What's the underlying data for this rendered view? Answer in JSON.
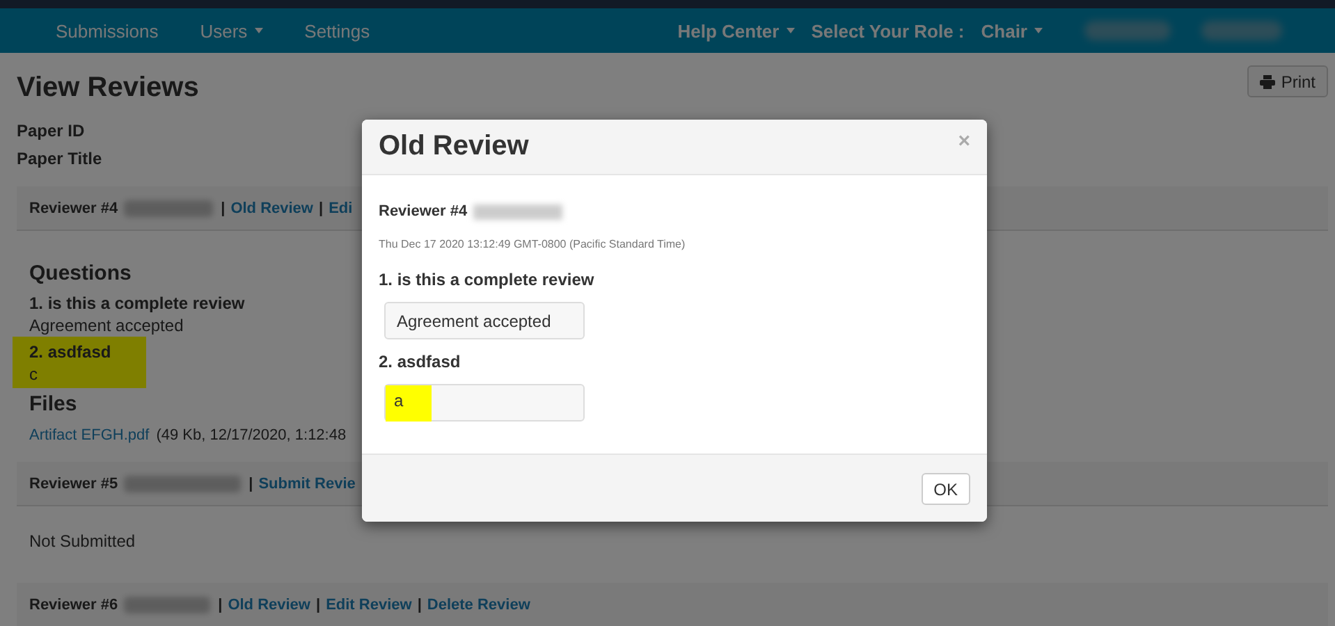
{
  "navbar": {
    "left_items": [
      {
        "label": "Submissions",
        "dropdown": false
      },
      {
        "label": "Users",
        "dropdown": true
      },
      {
        "label": "Settings",
        "dropdown": false
      }
    ],
    "right_items": [
      {
        "label": "Help Center",
        "dropdown": true
      },
      {
        "label": "Select Your Role :",
        "dropdown": false
      },
      {
        "label": "Chair",
        "dropdown": true
      }
    ]
  },
  "page": {
    "title": "View Reviews",
    "print_button": "Print",
    "fields": [
      "Paper ID",
      "Paper Title"
    ]
  },
  "reviewers": [
    {
      "label": "Reviewer #4",
      "actions": [
        {
          "kind": "sep",
          "text": "|"
        },
        {
          "kind": "link",
          "text": "Old Review"
        },
        {
          "kind": "sep",
          "text": "|"
        },
        {
          "kind": "link",
          "text": "Edi"
        }
      ],
      "questions_heading": "Questions",
      "questions": [
        {
          "question": "1. is this a complete review",
          "answer": "Agreement accepted",
          "highlighted": false
        },
        {
          "question": "2. asdfasd",
          "answer": "c",
          "highlighted": true
        }
      ],
      "files_heading": "Files",
      "files": [
        {
          "name": "Artifact EFGH.pdf",
          "meta": "(49 Kb, 12/17/2020, 1:12:48"
        }
      ]
    },
    {
      "label": "Reviewer #5",
      "actions": [
        {
          "kind": "sep",
          "text": "|"
        },
        {
          "kind": "link",
          "text": "Submit Revie"
        }
      ],
      "status": "Not Submitted"
    },
    {
      "label": "Reviewer #6",
      "actions": [
        {
          "kind": "sep",
          "text": "|"
        },
        {
          "kind": "link",
          "text": "Old Review"
        },
        {
          "kind": "sep",
          "text": "|"
        },
        {
          "kind": "link",
          "text": "Edit Review"
        },
        {
          "kind": "sep",
          "text": "|"
        },
        {
          "kind": "link",
          "text": "Delete Review"
        }
      ]
    }
  ],
  "modal": {
    "title": "Old Review",
    "close": "×",
    "reviewer": "Reviewer #4",
    "timestamp": "Thu Dec 17 2020 13:12:49 GMT-0800 (Pacific Standard Time)",
    "questions": [
      {
        "question": "1. is this a complete review",
        "answer": "Agreement accepted",
        "highlighted": false
      },
      {
        "question": "2. asdfasd",
        "answer": "a",
        "highlighted": true
      }
    ],
    "ok_button": "OK"
  }
}
